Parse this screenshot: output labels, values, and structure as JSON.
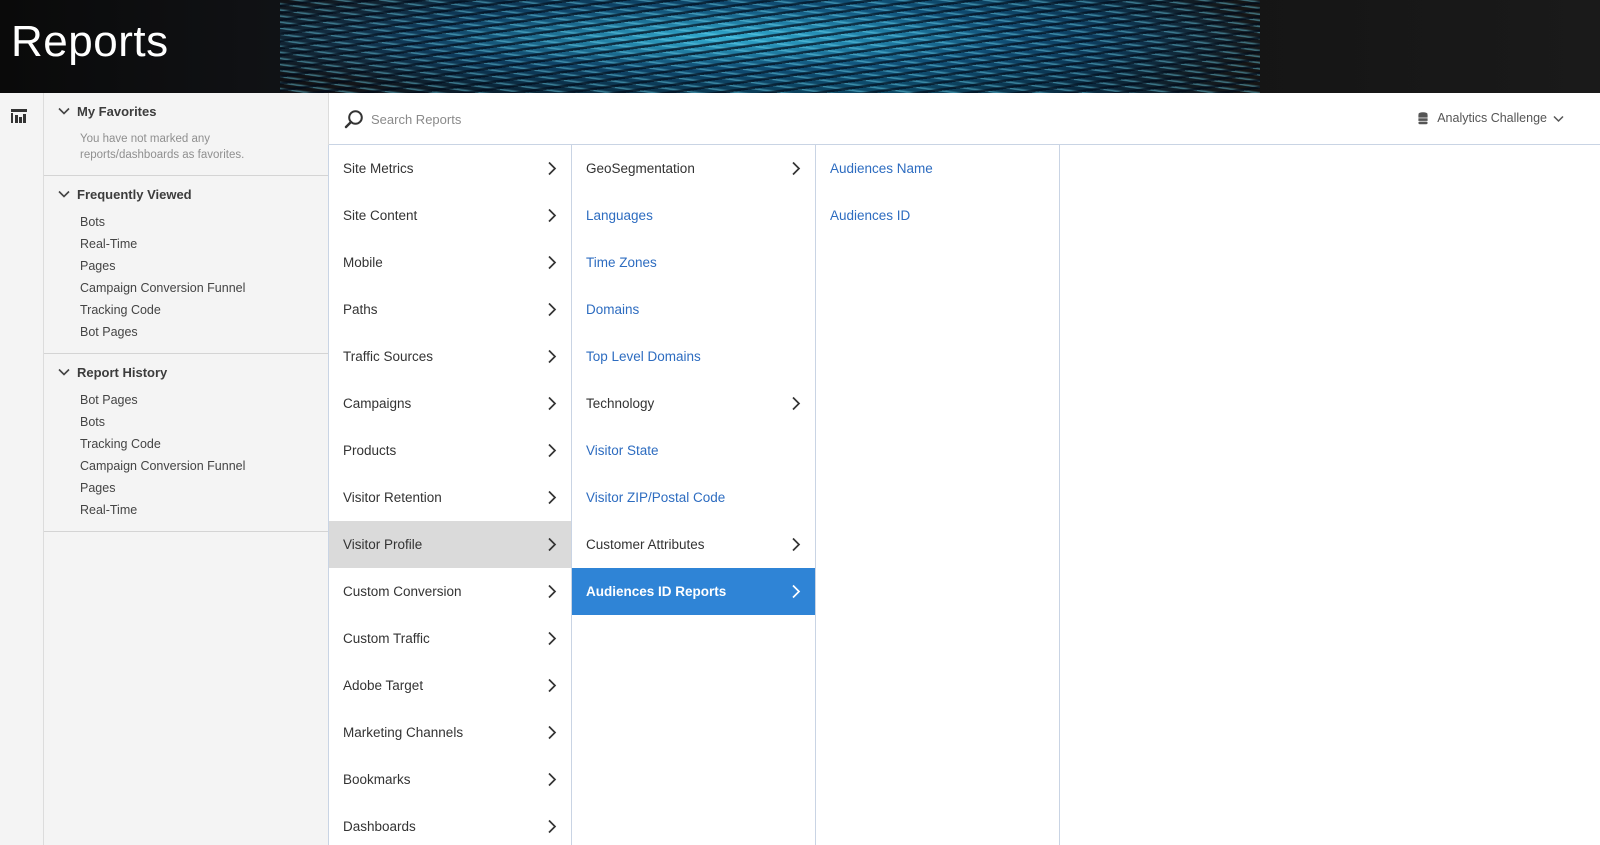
{
  "header": {
    "title": "Reports"
  },
  "rail": {
    "icon": "report-list-icon"
  },
  "left_panel": {
    "favorites": {
      "title": "My Favorites",
      "empty_text": "You have not marked any reports/dashboards as favorites."
    },
    "frequently_viewed": {
      "title": "Frequently Viewed",
      "items": [
        "Bots",
        "Real-Time",
        "Pages",
        "Campaign Conversion Funnel",
        "Tracking Code",
        "Bot Pages"
      ]
    },
    "report_history": {
      "title": "Report History",
      "items": [
        "Bot Pages",
        "Bots",
        "Tracking Code",
        "Campaign Conversion Funnel",
        "Pages",
        "Real-Time"
      ]
    }
  },
  "search": {
    "placeholder": "Search Reports",
    "value": ""
  },
  "report_suite": {
    "label": "Analytics Challenge"
  },
  "columns": {
    "col1": [
      {
        "label": "Site Metrics",
        "submenu": true
      },
      {
        "label": "Site Content",
        "submenu": true
      },
      {
        "label": "Mobile",
        "submenu": true
      },
      {
        "label": "Paths",
        "submenu": true
      },
      {
        "label": "Traffic Sources",
        "submenu": true
      },
      {
        "label": "Campaigns",
        "submenu": true
      },
      {
        "label": "Products",
        "submenu": true
      },
      {
        "label": "Visitor Retention",
        "submenu": true
      },
      {
        "label": "Visitor Profile",
        "submenu": true,
        "state": "selected"
      },
      {
        "label": "Custom Conversion",
        "submenu": true
      },
      {
        "label": "Custom Traffic",
        "submenu": true
      },
      {
        "label": "Adobe Target",
        "submenu": true
      },
      {
        "label": "Marketing Channels",
        "submenu": true
      },
      {
        "label": "Bookmarks",
        "submenu": true
      },
      {
        "label": "Dashboards",
        "submenu": true
      }
    ],
    "col2": [
      {
        "label": "GeoSegmentation",
        "submenu": true
      },
      {
        "label": "Languages",
        "submenu": false
      },
      {
        "label": "Time Zones",
        "submenu": false
      },
      {
        "label": "Domains",
        "submenu": false
      },
      {
        "label": "Top Level Domains",
        "submenu": false
      },
      {
        "label": "Technology",
        "submenu": true
      },
      {
        "label": "Visitor State",
        "submenu": false
      },
      {
        "label": "Visitor ZIP/Postal Code",
        "submenu": false
      },
      {
        "label": "Customer Attributes",
        "submenu": true
      },
      {
        "label": "Audiences ID Reports",
        "submenu": true,
        "state": "active"
      }
    ],
    "col3": [
      {
        "label": "Audiences Name",
        "submenu": false
      },
      {
        "label": "Audiences ID",
        "submenu": false
      }
    ]
  },
  "colors": {
    "accent": "#2f84d6",
    "link": "#2d6cc0",
    "selected_bg": "#dadada",
    "panel_bg": "#f4f4f4"
  }
}
